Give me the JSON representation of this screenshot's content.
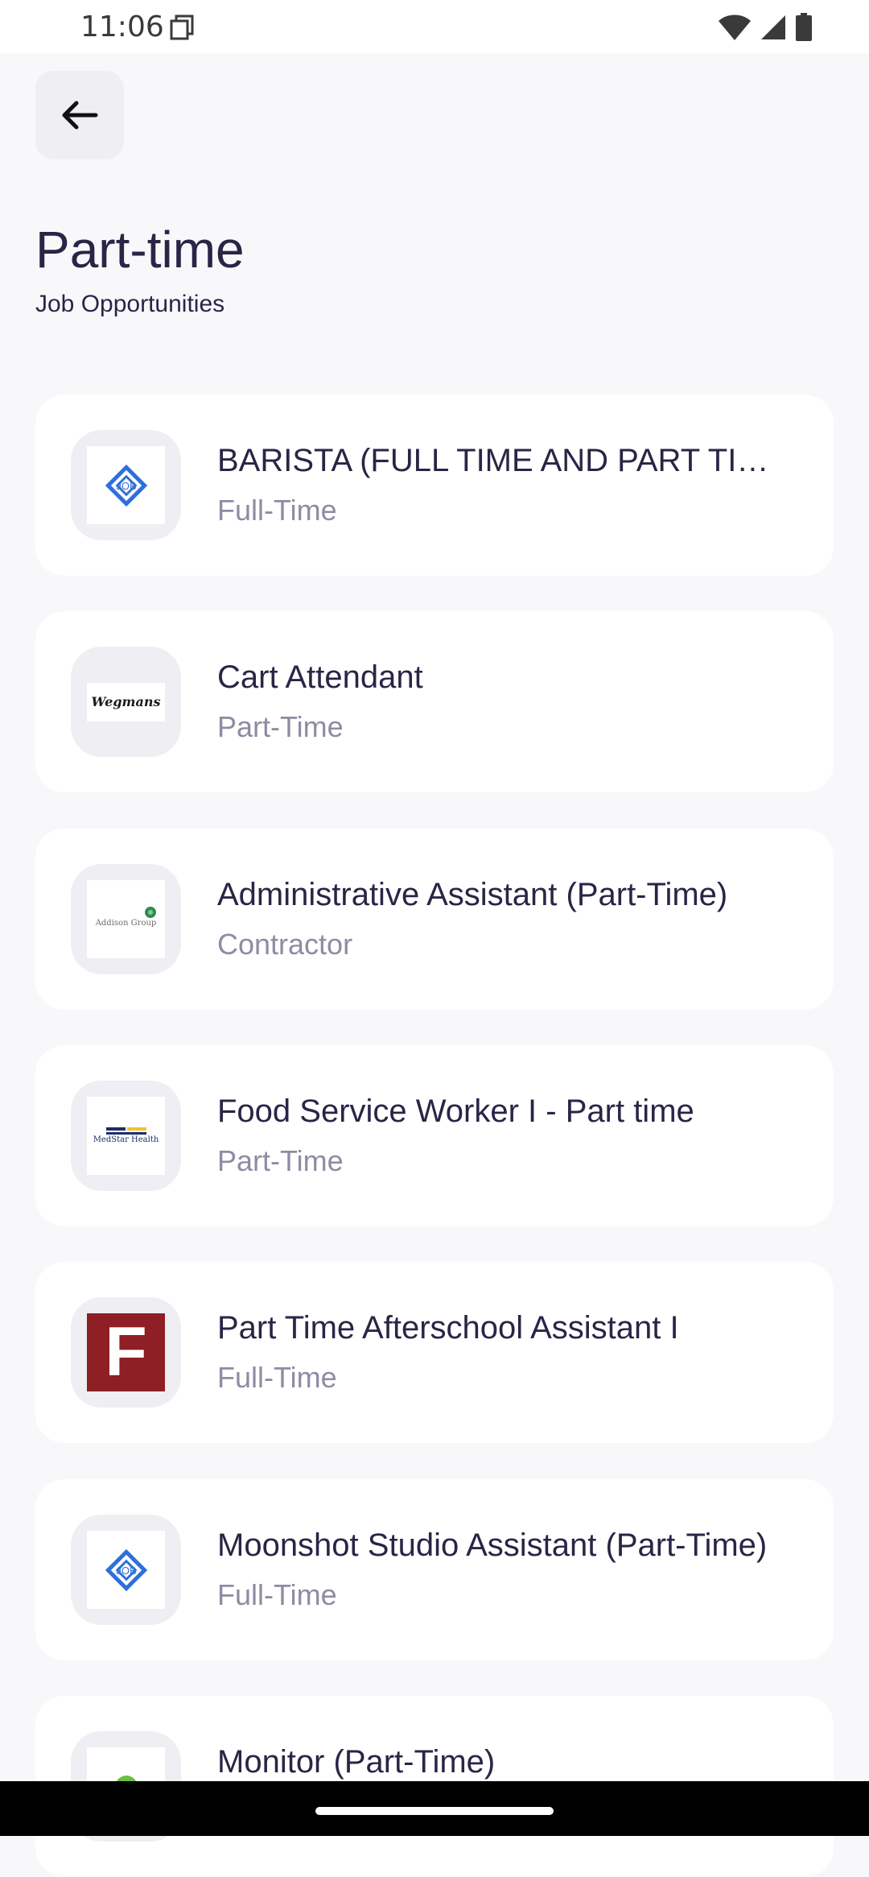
{
  "status_bar": {
    "time": "11:06"
  },
  "header": {
    "title": "Part-time",
    "subtitle": "Job Opportunities"
  },
  "jobs": [
    {
      "title": "BARISTA (FULL TIME AND PART TIME)",
      "type": "Full-Time",
      "logo": "job-logo"
    },
    {
      "title": "Cart Attendant",
      "type": "Part-Time",
      "logo": "wegmans-logo",
      "logo_text": "Wegmans"
    },
    {
      "title": "Administrative Assistant (Part-Time)",
      "type": "Contractor",
      "logo": "addison-group-logo",
      "logo_text": "Addison Group"
    },
    {
      "title": "Food Service Worker I - Part time",
      "type": "Part-Time",
      "logo": "medstar-health-logo",
      "logo_text": "MedStar Health"
    },
    {
      "title": "Part Time Afterschool Assistant I",
      "type": "Full-Time",
      "logo": "f-logo",
      "logo_text": "F"
    },
    {
      "title": "Moonshot Studio Assistant (Part-Time)",
      "type": "Full-Time",
      "logo": "job-logo"
    },
    {
      "title": "Monitor (Part-Time)",
      "type": "",
      "logo": "green-logo"
    }
  ],
  "colors": {
    "background": "#F8F8FB",
    "card": "#FFFFFF",
    "title_text": "#2A2546",
    "secondary_text": "#8E8CA3",
    "logo_tile": "#EFEFF3",
    "job_logo_blue": "#2F6FDB",
    "f_logo_red": "#8E1F24"
  }
}
